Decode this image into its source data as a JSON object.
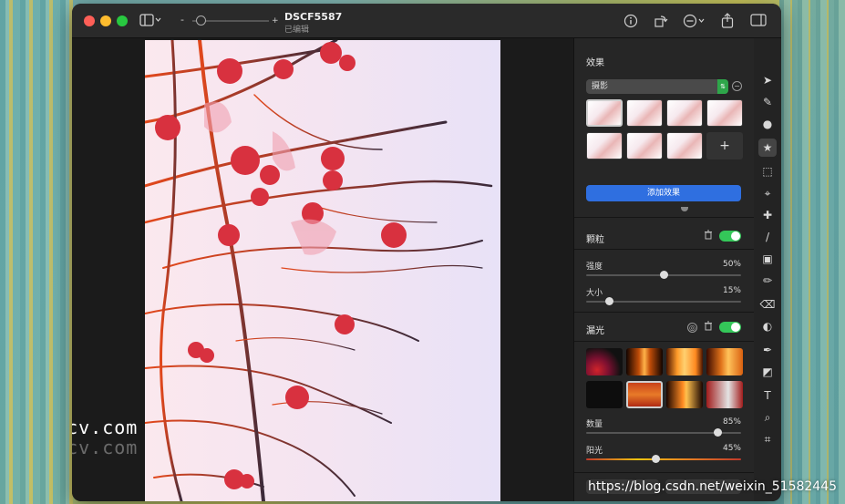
{
  "window": {
    "title": "DSCF5587",
    "subtitle": "已编辑",
    "zoom_minus": "-",
    "zoom_plus": "+"
  },
  "panel": {
    "effects": {
      "title": "效果",
      "dropdown_value": "摄影",
      "add_label": "添加效果",
      "plus_label": "+"
    },
    "grain": {
      "title": "颗粒",
      "intensity_label": "强度",
      "intensity_value": "50%",
      "intensity_fraction": 0.5,
      "size_label": "大小",
      "size_value": "15%",
      "size_fraction": 0.15
    },
    "light_leak": {
      "title": "漏光",
      "amount_label": "数量",
      "amount_value": "85%",
      "amount_fraction": 0.85,
      "sun_label": "阳光",
      "sun_value": "45%",
      "sun_fraction": 0.45
    }
  },
  "overlay": {
    "watermark": "Macv.com",
    "watermark_shadow": "Macv.com",
    "csdn": "https://blog.csdn.net/weixin_51582445"
  },
  "colors": {
    "accent_blue": "#2f6fe0",
    "toggle_green": "#34c759",
    "traffic_red": "#fe5f57",
    "traffic_yellow": "#febc2e",
    "traffic_green": "#28c840"
  }
}
